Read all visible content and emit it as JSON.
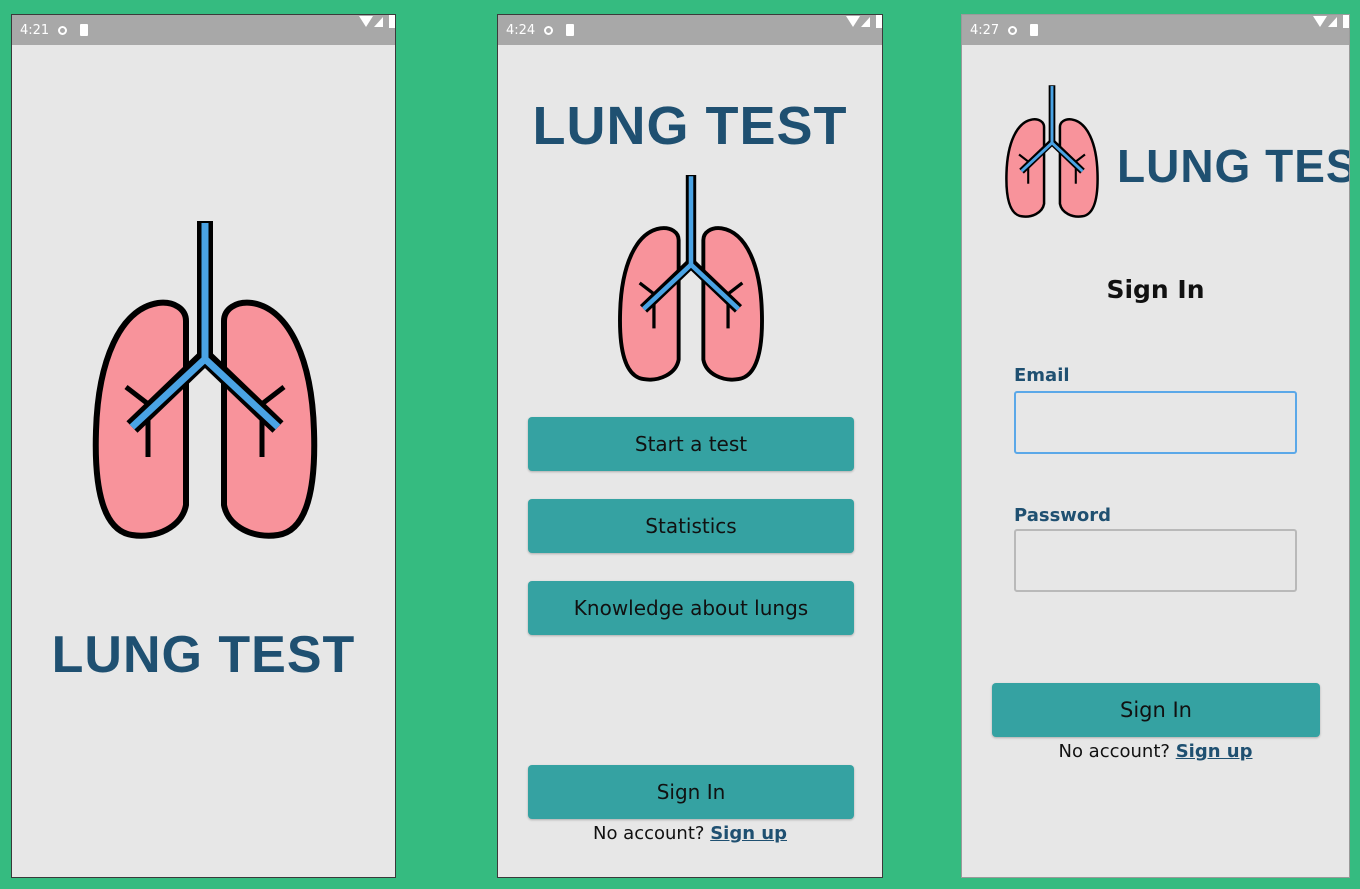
{
  "colors": {
    "background": "#35bb80",
    "screen": "#e7e7e7",
    "statusbar": "#a8a8a8",
    "accent_button": "#35a2a2",
    "logo_text": "#1f5071",
    "lung_fill": "#f8939b",
    "bronchi": "#4aa3e4"
  },
  "screens": {
    "splash": {
      "status_time": "4:21",
      "logo_title": "LUNG TEST",
      "logo_icon": "lungs-icon"
    },
    "menu": {
      "status_time": "4:24",
      "logo_title": "LUNG TEST",
      "logo_icon": "lungs-icon",
      "buttons": {
        "start_test": "Start a test",
        "statistics": "Statistics",
        "knowledge": "Knowledge about lungs",
        "sign_in": "Sign In"
      },
      "no_account": "No account?",
      "sign_up": "Sign up"
    },
    "signin": {
      "status_time": "4:27",
      "logo_title": "LUNG TEST",
      "logo_icon": "lungs-icon",
      "heading": "Sign In",
      "email_label": "Email",
      "email_value": "",
      "password_label": "Password",
      "password_value": "",
      "sign_in_button": "Sign In",
      "no_account": "No account?",
      "sign_up": "Sign up"
    }
  }
}
